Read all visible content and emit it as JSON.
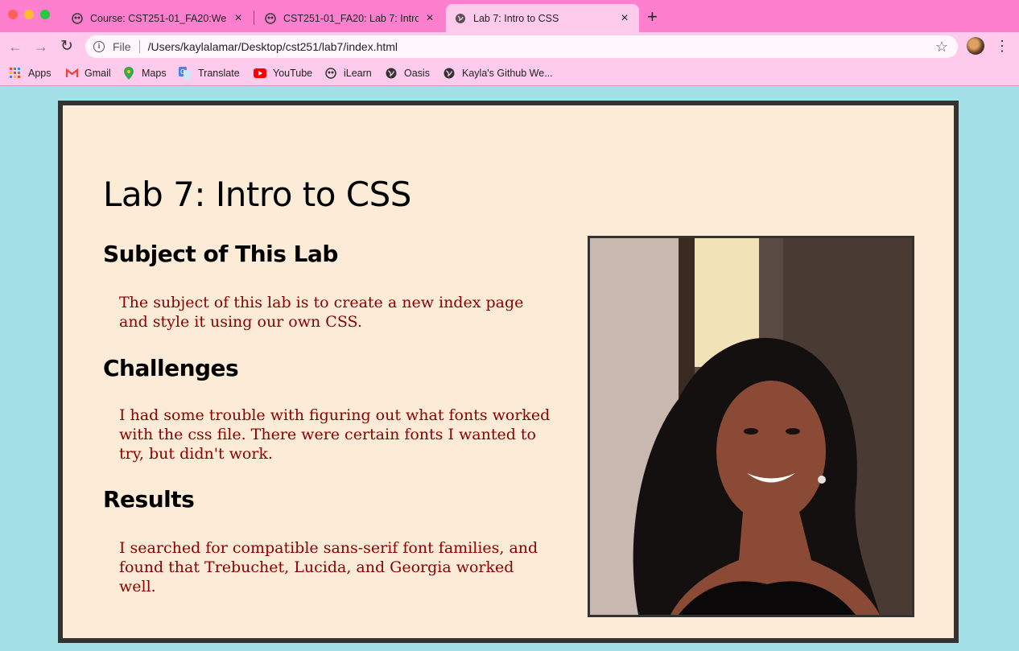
{
  "browser": {
    "tabs": [
      {
        "title": "Course: CST251-01_FA20:Web",
        "favicon": "moodle-icon",
        "active": false
      },
      {
        "title": "CST251-01_FA20: Lab 7: Intro t",
        "favicon": "moodle-icon",
        "active": false
      },
      {
        "title": "Lab 7: Intro to CSS",
        "favicon": "globe-icon",
        "active": true
      }
    ],
    "address": {
      "scheme_label": "File",
      "url": "/Users/kaylalamar/Desktop/cst251/lab7/index.html"
    },
    "bookmarks": [
      {
        "label": "Apps",
        "icon": "apps-grid-icon"
      },
      {
        "label": "Gmail",
        "icon": "gmail-icon"
      },
      {
        "label": "Maps",
        "icon": "maps-pin-icon"
      },
      {
        "label": "Translate",
        "icon": "translate-icon"
      },
      {
        "label": "YouTube",
        "icon": "youtube-icon"
      },
      {
        "label": "iLearn",
        "icon": "moodle-icon"
      },
      {
        "label": "Oasis",
        "icon": "globe-icon"
      },
      {
        "label": "Kayla's Github We...",
        "icon": "globe-icon"
      }
    ],
    "colors": {
      "chrome": "#ff7fcf",
      "toolbar": "#ffcbed"
    }
  },
  "page": {
    "title": "Lab 7: Intro to CSS",
    "sections": [
      {
        "heading": "Subject of This Lab",
        "body": "The subject of this lab is to create a new index page and style it using our own CSS."
      },
      {
        "heading": "Challenges",
        "body": "I had some trouble with figuring out what fonts worked with the css file. There were certain fonts I wanted to try, but didn't work."
      },
      {
        "heading": "Results",
        "body": "I searched for compatible sans-serif font families, and found that Trebuchet, Lucida, and Georgia worked well."
      }
    ],
    "colors": {
      "background": "#a4e0e8",
      "card": "#fbebd7",
      "border": "#333333",
      "body_text": "#8b0000"
    }
  }
}
